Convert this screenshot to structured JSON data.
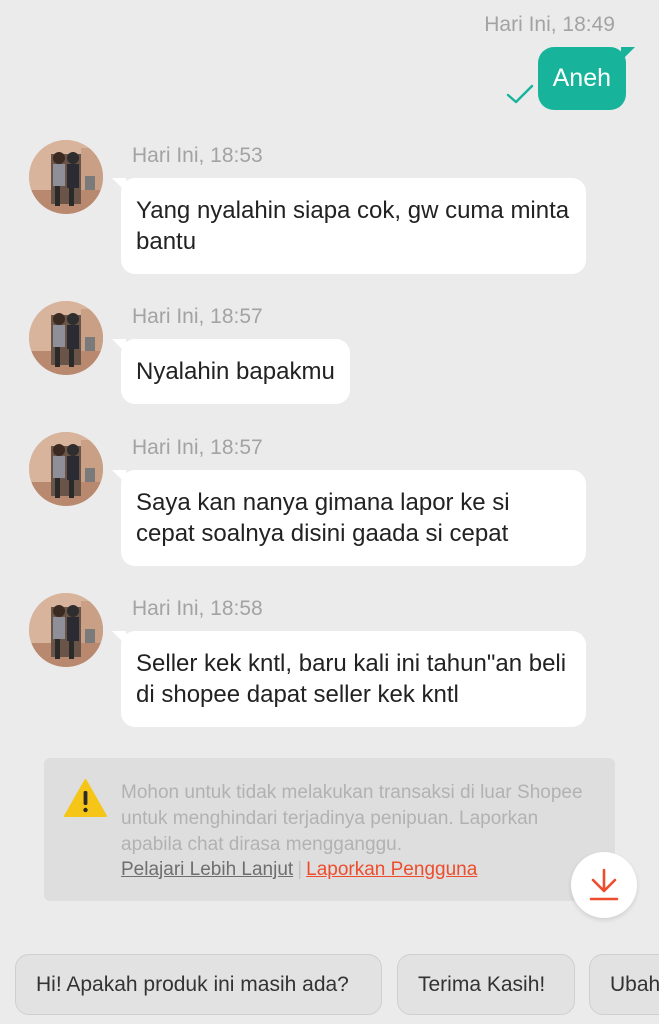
{
  "outgoing": {
    "timestamp": "Hari Ini, 18:49",
    "text": "Aneh",
    "status_icon": "check-icon"
  },
  "messages": [
    {
      "timestamp": "Hari Ini, 18:53",
      "text": "Yang nyalahin siapa cok, gw cuma minta bantu"
    },
    {
      "timestamp": "Hari Ini, 18:57",
      "text": "Nyalahin bapakmu"
    },
    {
      "timestamp": "Hari Ini, 18:57",
      "text": "Saya kan nanya gimana lapor ke si cepat soalnya disini gaada si cepat"
    },
    {
      "timestamp": "Hari Ini, 18:58",
      "text": "Seller kek kntl, baru kali ini tahun\"an beli di shopee dapat seller kek kntl"
    }
  ],
  "notice": {
    "icon": "warning-icon",
    "text": "Mohon untuk tidak melakukan transaksi di luar Shopee untuk menghindari terjadinya penipuan. Laporkan apabila chat dirasa mengganggu.",
    "learn_more": "Pelajari Lebih Lanjut",
    "separator": "|",
    "report_user": "Laporkan Pengguna"
  },
  "scroll_button_icon": "arrow-down-icon",
  "quick_replies": [
    "Hi! Apakah produk ini masih ada?",
    "Terima Kasih!",
    "Ubah"
  ],
  "colors": {
    "background": "#ebebeb",
    "outgoing_bubble": "#17b49b",
    "incoming_bubble": "#ffffff",
    "link_report": "#ee4d2d",
    "warning_yellow": "#f5c518"
  }
}
